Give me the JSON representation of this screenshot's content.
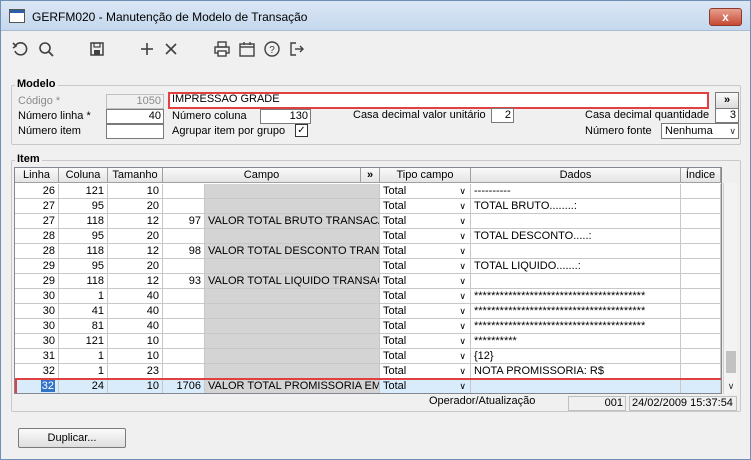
{
  "window": {
    "title": "GERFM020 - Manutenção de Modelo de Transação",
    "close_label": "x"
  },
  "toolbar": {
    "icons": [
      "undo-icon",
      "search-icon",
      "save-icon",
      "add-icon",
      "delete-icon",
      "print-icon",
      "calendar-icon",
      "help-icon",
      "exit-icon"
    ]
  },
  "modelo": {
    "section_title": "Modelo",
    "codigo_label": "Código *",
    "codigo_value": "1050",
    "descricao_value": "IMPRESSAO GRADE",
    "expand_label": "»",
    "numero_linha_label": "Número linha *",
    "numero_linha_value": "40",
    "numero_coluna_label": "Número coluna",
    "numero_coluna_value": "130",
    "casa_unit_label": "Casa decimal valor unitário",
    "casa_unit_value": "2",
    "casa_qtd_label": "Casa decimal quantidade",
    "casa_qtd_value": "3",
    "numero_item_label": "Número item",
    "numero_item_value": "",
    "agrupar_label": "Agrupar item por grupo",
    "agrupar_checked": "✓",
    "numero_fonte_label": "Número fonte",
    "numero_fonte_value": "Nenhuma"
  },
  "item": {
    "section_title": "Item",
    "headers": {
      "linha": "Linha",
      "coluna": "Coluna",
      "tamanho": "Tamanho",
      "campo": "Campo",
      "expand": "»",
      "tipo": "Tipo campo",
      "dados": "Dados",
      "indice": "Índice"
    },
    "rows": [
      {
        "linha": "26",
        "coluna": "121",
        "tamanho": "10",
        "num": "",
        "campo": "",
        "tipo": "Total",
        "dados": "----------",
        "indice": ""
      },
      {
        "linha": "27",
        "coluna": "95",
        "tamanho": "20",
        "num": "",
        "campo": "",
        "tipo": "Total",
        "dados": "TOTAL BRUTO........:",
        "indice": ""
      },
      {
        "linha": "27",
        "coluna": "118",
        "tamanho": "12",
        "num": "97",
        "campo": "VALOR TOTAL BRUTO TRANSACA",
        "tipo": "Total",
        "dados": "",
        "indice": ""
      },
      {
        "linha": "28",
        "coluna": "95",
        "tamanho": "20",
        "num": "",
        "campo": "",
        "tipo": "Total",
        "dados": "TOTAL DESCONTO.....:",
        "indice": ""
      },
      {
        "linha": "28",
        "coluna": "118",
        "tamanho": "12",
        "num": "98",
        "campo": "VALOR TOTAL DESCONTO TRANSA",
        "tipo": "Total",
        "dados": "",
        "indice": ""
      },
      {
        "linha": "29",
        "coluna": "95",
        "tamanho": "20",
        "num": "",
        "campo": "",
        "tipo": "Total",
        "dados": "TOTAL LIQUIDO.......:",
        "indice": ""
      },
      {
        "linha": "29",
        "coluna": "118",
        "tamanho": "12",
        "num": "93",
        "campo": "VALOR TOTAL LIQUIDO TRANSACA",
        "tipo": "Total",
        "dados": "",
        "indice": ""
      },
      {
        "linha": "30",
        "coluna": "1",
        "tamanho": "40",
        "num": "",
        "campo": "",
        "tipo": "Total",
        "dados": "****************************************",
        "indice": ""
      },
      {
        "linha": "30",
        "coluna": "41",
        "tamanho": "40",
        "num": "",
        "campo": "",
        "tipo": "Total",
        "dados": "****************************************",
        "indice": ""
      },
      {
        "linha": "30",
        "coluna": "81",
        "tamanho": "40",
        "num": "",
        "campo": "",
        "tipo": "Total",
        "dados": "****************************************",
        "indice": ""
      },
      {
        "linha": "30",
        "coluna": "121",
        "tamanho": "10",
        "num": "",
        "campo": "",
        "tipo": "Total",
        "dados": "**********",
        "indice": ""
      },
      {
        "linha": "31",
        "coluna": "1",
        "tamanho": "10",
        "num": "",
        "campo": "",
        "tipo": "Total",
        "dados": "{12}",
        "indice": ""
      },
      {
        "linha": "32",
        "coluna": "1",
        "tamanho": "23",
        "num": "",
        "campo": "",
        "tipo": "Total",
        "dados": "NOTA PROMISSORIA: R$",
        "indice": ""
      },
      {
        "linha": "32",
        "coluna": "24",
        "tamanho": "10",
        "num": "1706",
        "campo": "VALOR TOTAL PROMISSORIA EM A",
        "tipo": "Total",
        "dados": "",
        "indice": ""
      }
    ]
  },
  "footer": {
    "operador_label": "Operador/Atualização",
    "operador_value": "001",
    "data_value": "24/02/2009 15:37:54",
    "duplicar_label": "Duplicar..."
  }
}
